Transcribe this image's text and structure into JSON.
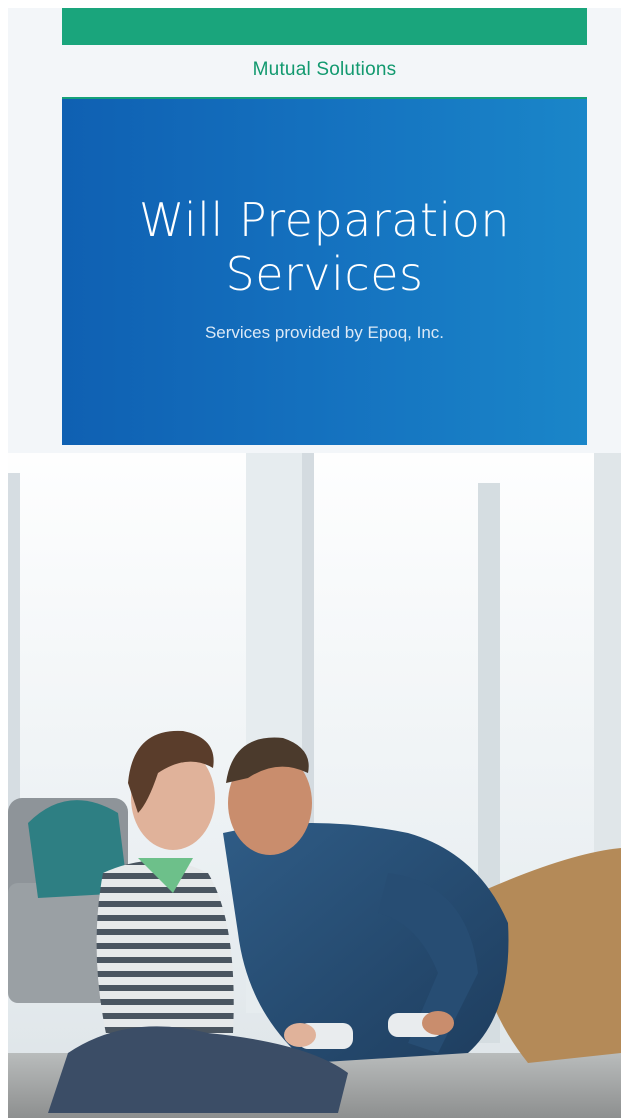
{
  "brand": "Mutual Solutions",
  "hero": {
    "title_line1": "Will Preparation",
    "title_line2": "Services",
    "subtitle": "Services provided by Epoq, Inc."
  },
  "colors": {
    "brand_green": "#1aa57c",
    "hero_blue": "#1573c0"
  }
}
